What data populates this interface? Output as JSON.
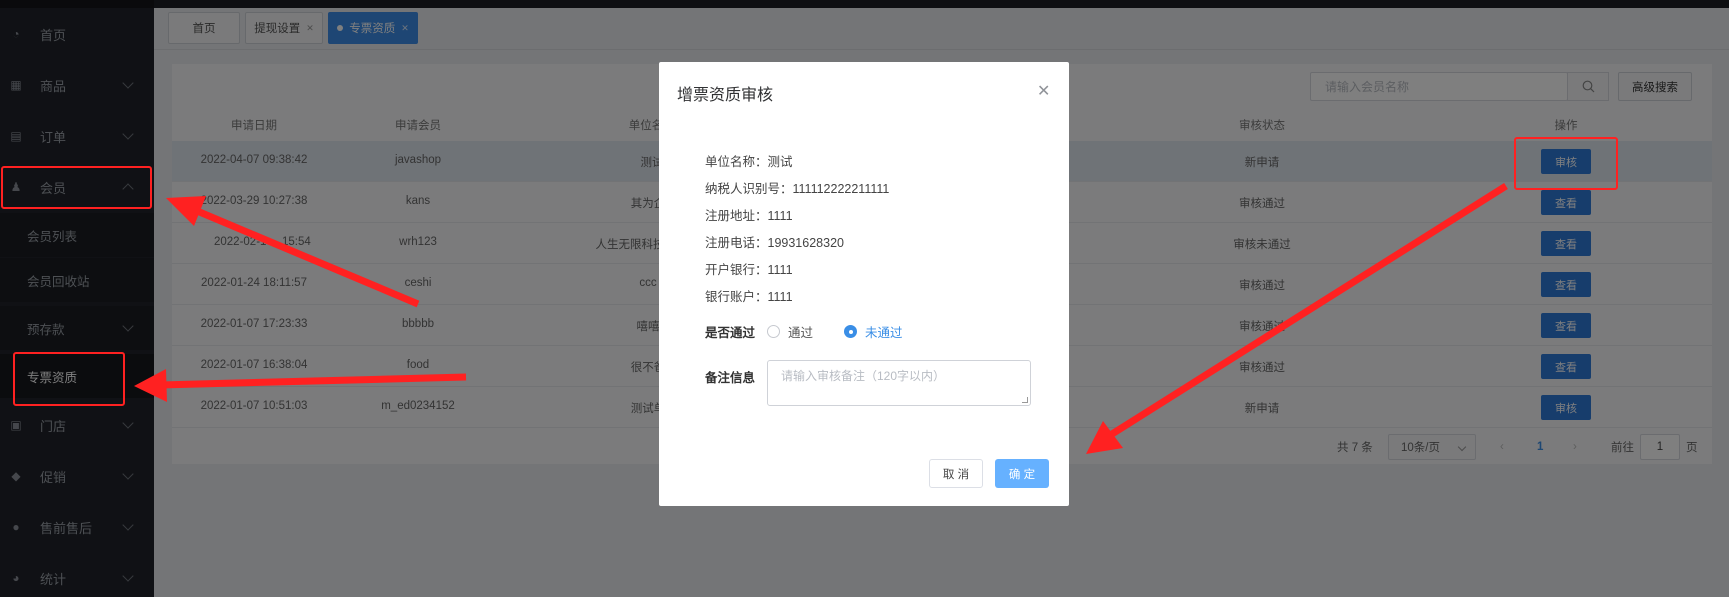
{
  "sidebar": {
    "menu": [
      {
        "label": "首页",
        "icon": "dashboard-icon"
      },
      {
        "label": "商品",
        "icon": "goods-icon"
      },
      {
        "label": "订单",
        "icon": "order-icon"
      },
      {
        "label": "会员",
        "icon": "member-icon"
      },
      {
        "label": "门店",
        "icon": "store-icon"
      },
      {
        "label": "促销",
        "icon": "promotion-icon"
      },
      {
        "label": "售前售后",
        "icon": "service-icon"
      },
      {
        "label": "统计",
        "icon": "stats-icon"
      }
    ],
    "submenu": [
      "会员列表",
      "会员回收站",
      "预存款",
      "专票资质"
    ]
  },
  "tabs": {
    "home": "首页",
    "withdraw": "提现设置",
    "invoice": "专票资质"
  },
  "toolbar": {
    "search_placeholder": "请输入会员名称",
    "advanced_search": "高级搜索"
  },
  "table": {
    "headers": [
      "申请日期",
      "申请会员",
      "单位名",
      "审核状态",
      "操作"
    ],
    "rows": [
      {
        "date": "2022-04-07 09:38:42",
        "member": "javashop",
        "unit": "测试",
        "status": "新申请",
        "action": "审核"
      },
      {
        "date": "2022-03-29 10:27:38",
        "member": "kans",
        "unit": "其为企",
        "status": "审核通过",
        "action": "查看"
      },
      {
        "date": "2022-02-1",
        "date_tail": "15:54",
        "member": "wrh123",
        "unit": "人生无限科技",
        "status": "审核未通过",
        "action": "查看"
      },
      {
        "date": "2022-01-24 18:11:57",
        "member": "ceshi",
        "unit": "ccc",
        "status": "审核通过",
        "action": "查看"
      },
      {
        "date": "2022-01-07 17:23:33",
        "member": "bbbbb",
        "unit": "嘻嘻",
        "status": "审核通过",
        "action": "查看"
      },
      {
        "date": "2022-01-07 16:38:04",
        "member": "food",
        "unit": "很不爸",
        "status": "审核通过",
        "action": "查看"
      },
      {
        "date": "2022-01-07 10:51:03",
        "member": "m_ed0234152",
        "unit": "测试单",
        "status": "新申请",
        "action": "审核"
      }
    ]
  },
  "pagination": {
    "total": "共 7 条",
    "page_size": "10条/页",
    "current": "1",
    "goto_label": "前往",
    "goto_value": "1",
    "page_suffix": "页"
  },
  "modal": {
    "title": "增票资质审核",
    "unit_name": "单位名称：测试",
    "tax_id": "纳税人识别号：111112222211111",
    "reg_address": "注册地址：1111",
    "reg_phone": "注册电话：19931628320",
    "bank": "开户银行：1111",
    "account": "银行账户：1111",
    "pass_label": "是否通过",
    "opt_pass": "通过",
    "opt_fail": "未通过",
    "remark_label": "备注信息",
    "remark_placeholder": "请输入审核备注（120字以内）",
    "cancel": "取 消",
    "confirm": "确 定"
  },
  "colors": {
    "annotation": "#ff2121",
    "primary": "#2f7ad8",
    "sidebar": "#20232a"
  }
}
